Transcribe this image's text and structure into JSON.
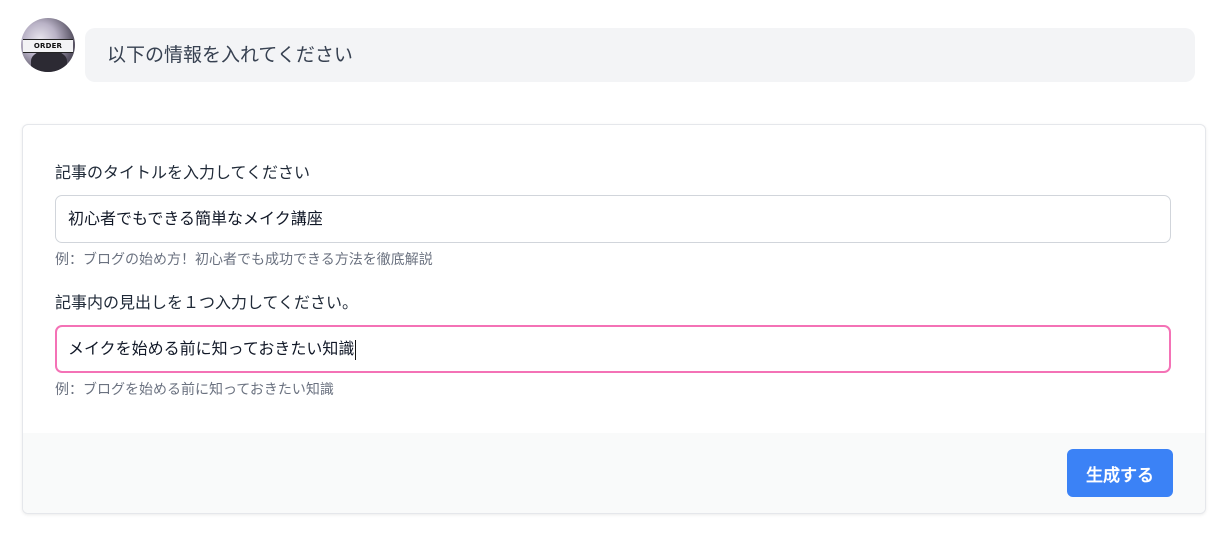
{
  "chat": {
    "avatar_text": "ORDER",
    "message": "以下の情報を入れてください"
  },
  "form": {
    "title_field": {
      "label": "記事のタイトルを入力してください",
      "value": "初心者でもできる簡単なメイク講座",
      "hint": "例：ブログの始め方！初心者でも成功できる方法を徹底解説"
    },
    "heading_field": {
      "label": "記事内の見出しを１つ入力してください。",
      "value": "メイクを始める前に知っておきたい知識",
      "hint": "例：ブログを始める前に知っておきたい知識"
    },
    "submit_label": "生成する"
  },
  "colors": {
    "accent": "#3b82f6",
    "focus_border": "#f472b6",
    "bubble_bg": "#f3f4f6"
  }
}
